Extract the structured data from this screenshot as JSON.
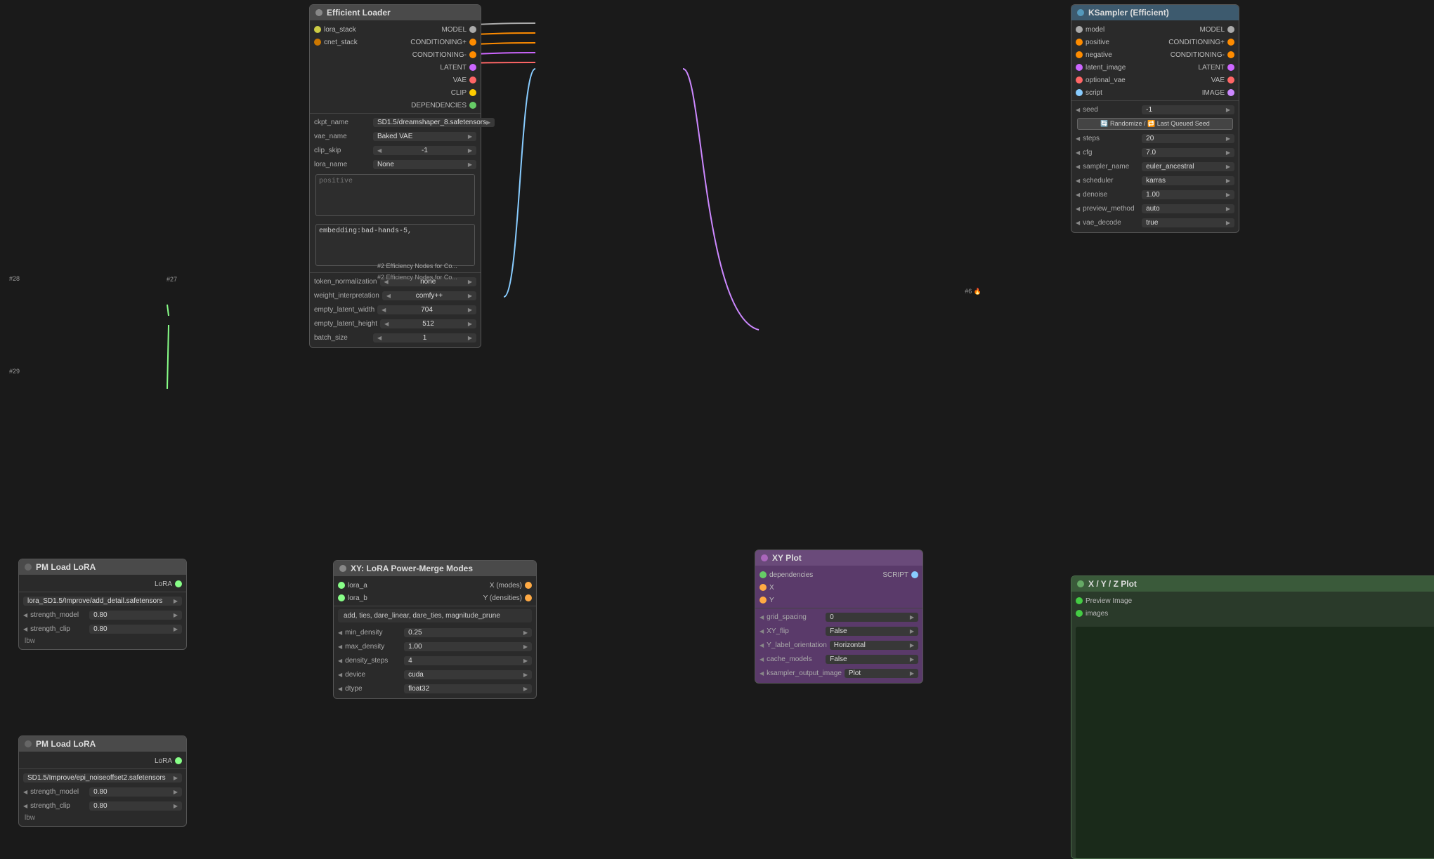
{
  "topLabel": "#2 Efficiency Nodes for Co...",
  "nodes": {
    "efficientLoader": {
      "id": "",
      "title": "Efficient Loader",
      "outputs": [
        {
          "label": "MODEL",
          "color": "model"
        },
        {
          "label": "CONDITIONING+",
          "color": "conditioning-pos"
        },
        {
          "label": "CONDITIONING-",
          "color": "conditioning-neg"
        },
        {
          "label": "LATENT",
          "color": "latent"
        },
        {
          "label": "VAE",
          "color": "vae"
        },
        {
          "label": "CLIP",
          "color": "clip"
        },
        {
          "label": "DEPENDENCIES",
          "color": "deps"
        }
      ],
      "inputs": [
        {
          "label": "lora_stack",
          "color": "yellow"
        },
        {
          "label": "cnet_stack",
          "color": "orange"
        }
      ],
      "fields": [
        {
          "label": "ckpt_name",
          "value": "SD1.5/dreamshaper_8.safetensors"
        },
        {
          "label": "vae_name",
          "value": "Baked VAE"
        },
        {
          "label": "clip_skip",
          "value": "-1"
        },
        {
          "label": "lora_name",
          "value": "None"
        }
      ],
      "textareas": [
        {
          "placeholder": "positive",
          "value": ""
        },
        {
          "placeholder": "",
          "value": "embedding:bad-hands-5,"
        }
      ],
      "bottomFields": [
        {
          "label": "token_normalization",
          "value": "none"
        },
        {
          "label": "weight_interpretation",
          "value": "comfy++"
        },
        {
          "label": "empty_latent_width",
          "value": "704"
        },
        {
          "label": "empty_latent_height",
          "value": "512"
        },
        {
          "label": "batch_size",
          "value": "1"
        }
      ]
    },
    "ksampler": {
      "title": "KSampler (Efficient)",
      "inputs": [
        {
          "label": "model",
          "color": "model"
        },
        {
          "label": "positive",
          "color": "conditioning-pos"
        },
        {
          "label": "negative",
          "color": "conditioning-neg"
        },
        {
          "label": "latent_image",
          "color": "latent"
        },
        {
          "label": "optional_vae",
          "color": "vae"
        },
        {
          "label": "script",
          "color": "script"
        }
      ],
      "outputs": [
        {
          "label": "MODEL",
          "color": "model"
        },
        {
          "label": "CONDITIONING+",
          "color": "conditioning-pos"
        },
        {
          "label": "CONDITIONING-",
          "color": "conditioning-neg"
        },
        {
          "label": "LATENT",
          "color": "latent"
        },
        {
          "label": "VAE",
          "color": "vae"
        },
        {
          "label": "IMAGE",
          "color": "image"
        }
      ],
      "fields": [
        {
          "label": "seed",
          "value": "-1"
        },
        {
          "label": "steps",
          "value": "20"
        },
        {
          "label": "cfg",
          "value": "7.0"
        },
        {
          "label": "sampler_name",
          "value": "euler_ancestral"
        },
        {
          "label": "scheduler",
          "value": "karras"
        },
        {
          "label": "denoise",
          "value": "1.00"
        },
        {
          "label": "preview_method",
          "value": "auto"
        },
        {
          "label": "vae_decode",
          "value": "true"
        }
      ],
      "randomizeBtn": "🔄 Randomize / 🔁 Last Queued Seed"
    },
    "xyPlot": {
      "title": "XY Plot",
      "inputs": [
        {
          "label": "dependencies",
          "color": "deps"
        }
      ],
      "outputs": [
        {
          "label": "SCRIPT",
          "color": "script"
        }
      ],
      "innerPorts": [
        {
          "label": "X",
          "color": "xy"
        },
        {
          "label": "Y",
          "color": "xy"
        }
      ],
      "fields": [
        {
          "label": "grid_spacing",
          "value": "0"
        },
        {
          "label": "XY_flip",
          "value": "False"
        },
        {
          "label": "Y_label_orientation",
          "value": "Horizontal"
        },
        {
          "label": "cache_models",
          "value": "False"
        },
        {
          "label": "ksampler_output_image",
          "value": "Plot"
        }
      ]
    },
    "xyLora": {
      "tag": "#27",
      "title": "XY: LoRA Power-Merge Modes",
      "inputs": [
        {
          "label": "lora_a",
          "color": "lora"
        },
        {
          "label": "lora_b",
          "color": "lora"
        }
      ],
      "outputs": [
        {
          "label": "X (modes)",
          "color": "xy"
        },
        {
          "label": "Y (densities)",
          "color": "xy"
        }
      ],
      "textValue": "add, ties, dare_linear, dare_ties, magnitude_prune",
      "fields": [
        {
          "label": "min_density",
          "value": "0.25"
        },
        {
          "label": "max_density",
          "value": "1.00"
        },
        {
          "label": "density_steps",
          "value": "4"
        },
        {
          "label": "device",
          "value": "cuda"
        },
        {
          "label": "dtype",
          "value": "float32"
        }
      ]
    },
    "pmLora28": {
      "tag": "#28",
      "title": "PM Load LoRA",
      "outputLabel": "LoRA",
      "outputColor": "lora",
      "loraFile": "lora_SD1.5/Improve/add_detail.safetensors",
      "fields": [
        {
          "label": "strength_model",
          "value": "0.80"
        },
        {
          "label": "strength_clip",
          "value": "0.80"
        }
      ],
      "lbw": "lbw"
    },
    "pmLora29": {
      "tag": "#29",
      "title": "PM Load LoRA",
      "outputLabel": "LoRA",
      "outputColor": "lora",
      "loraFile": "SD1.5/Improve/epi_noiseoffset2.safetensors",
      "fields": [
        {
          "label": "strength_model",
          "value": "0.80"
        },
        {
          "label": "strength_clip",
          "value": "0.80"
        }
      ],
      "lbw": "lbw"
    },
    "xyzPlot": {
      "tag": "#6",
      "title": "X / Y / Z Plot",
      "ports": [
        {
          "label": "Preview Image",
          "color": "green"
        },
        {
          "label": "images",
          "color": "green"
        }
      ]
    }
  }
}
